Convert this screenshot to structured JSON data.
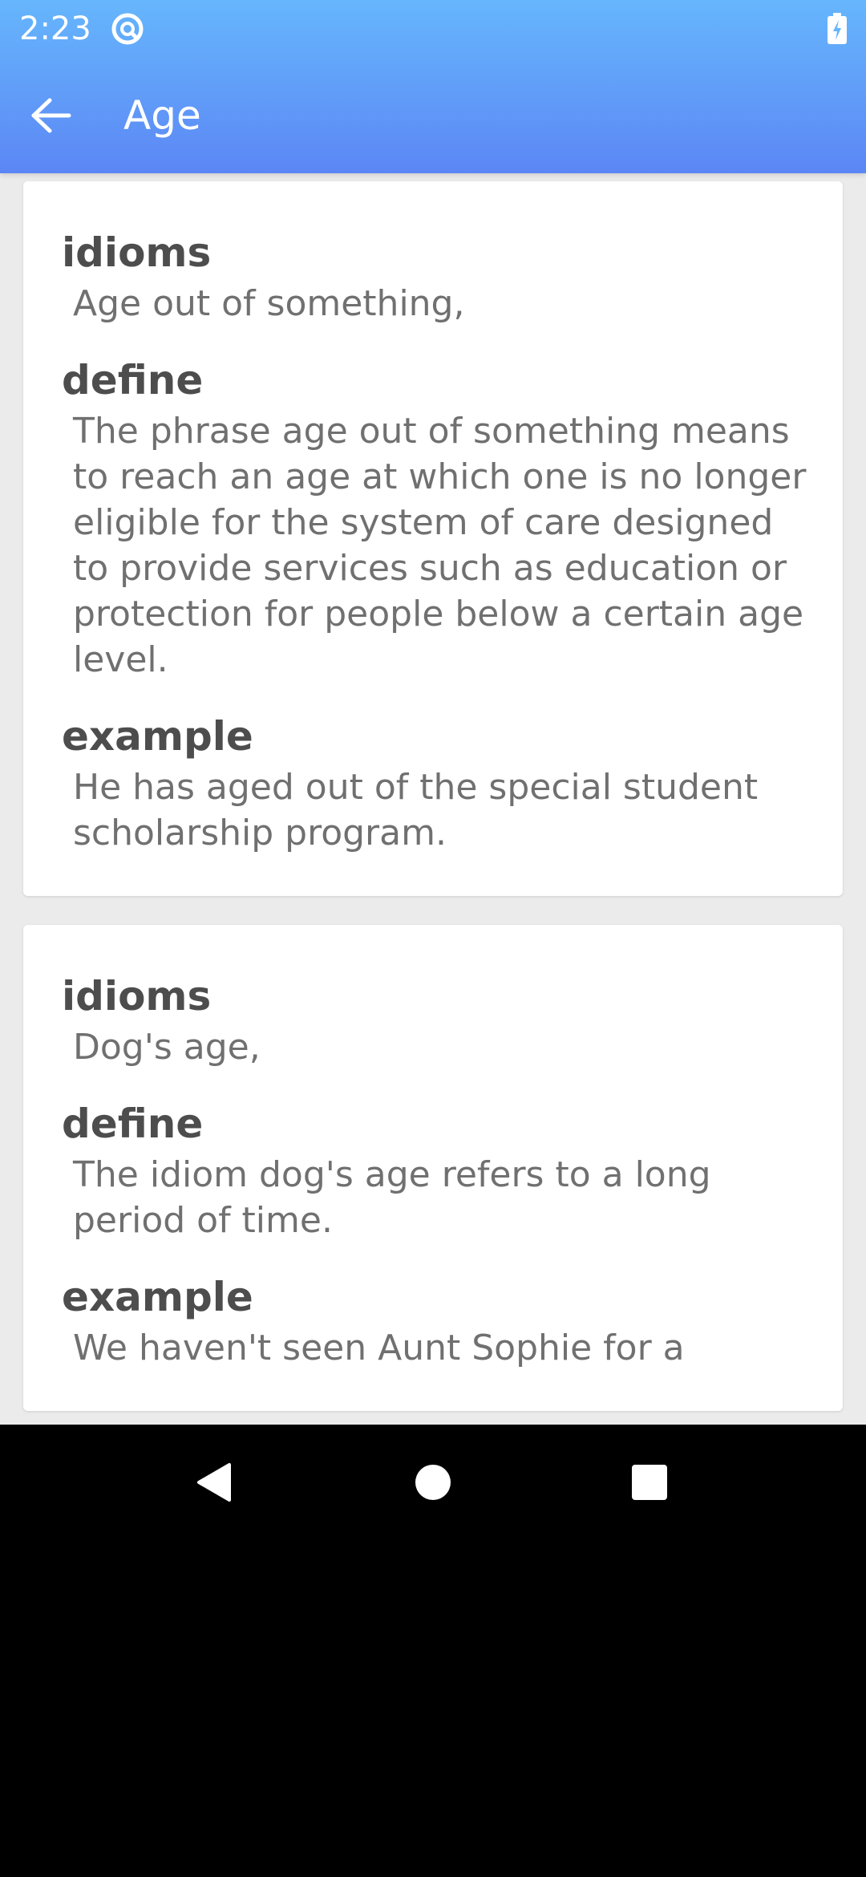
{
  "status_bar": {
    "time": "2:23",
    "app_icon": "at-sign-circle-icon",
    "battery_icon": "battery-charging-icon"
  },
  "toolbar": {
    "back_icon": "arrow-left-icon",
    "title": "Age"
  },
  "colors": {
    "header_top": "#66b6fd",
    "header_bottom": "#5b86f5",
    "background": "#ebebeb",
    "card": "#ffffff",
    "label_text": "#4d4d4d",
    "value_text": "#707070"
  },
  "cards": [
    {
      "idioms_label": "idioms",
      "idioms_value": "Age out of something,",
      "define_label": "define",
      "define_value": "The phrase age out of something means to reach an age at which one is no longer eligible for the system of care designed to provide services such as education or protection for people below a certain age level.",
      "example_label": "example",
      "example_value": "He has aged out of the special student scholarship program."
    },
    {
      "idioms_label": "idioms",
      "idioms_value": "Dog's age,",
      "define_label": "define",
      "define_value": "The idiom dog's age refers to a long period of time.",
      "example_label": "example",
      "example_value": "We haven't seen Aunt Sophie for a"
    }
  ],
  "nav_bar": {
    "back": "triangle-back-icon",
    "home": "circle-home-icon",
    "recents": "square-recents-icon"
  }
}
